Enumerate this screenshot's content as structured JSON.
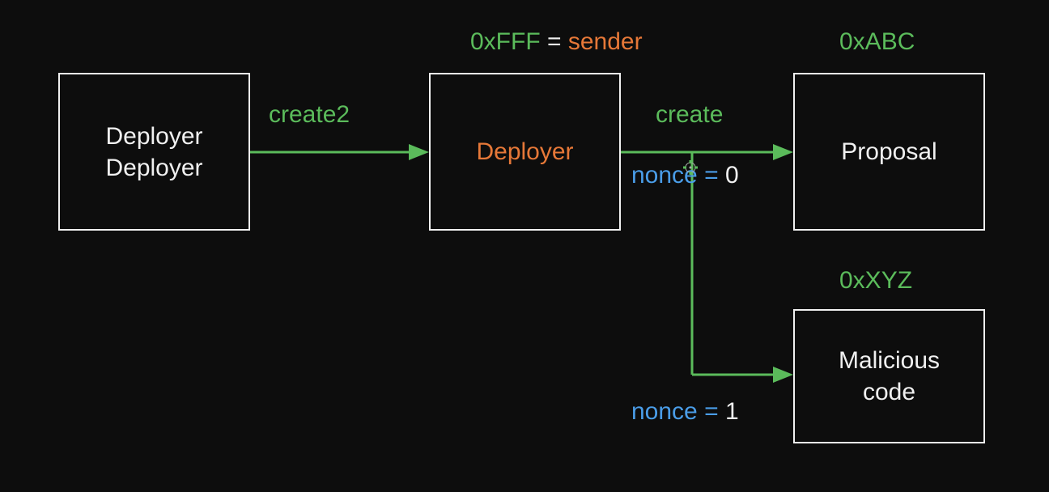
{
  "boxes": {
    "deployerDeployer": {
      "line1": "Deployer",
      "line2": "Deployer"
    },
    "deployer": {
      "label": "Deployer"
    },
    "proposal": {
      "label": "Proposal"
    },
    "malicious": {
      "line1": "Malicious",
      "line2": "code"
    }
  },
  "labels": {
    "create2": "create2",
    "create": "create",
    "senderAddr": "0xFFF",
    "senderEq": "= ",
    "senderText": "sender",
    "addr1": "0xABC",
    "addr2": "0xXYZ",
    "nonce0": "nonce = ",
    "nonce0val": "0",
    "nonce1": "nonce = ",
    "nonce1val": "1"
  }
}
